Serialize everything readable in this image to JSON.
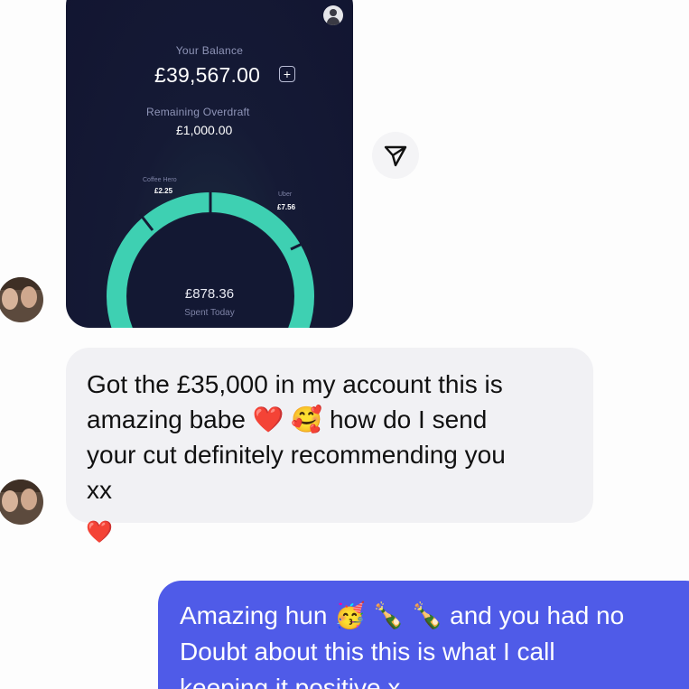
{
  "shared_image": {
    "balance_label": "Your Balance",
    "balance_value": "£39,567.00",
    "add_symbol": "+",
    "overdraft_label": "Remaining Overdraft",
    "overdraft_value": "£1,000.00",
    "segments": [
      {
        "label": "Coffee Hero",
        "value": "£2.25"
      },
      {
        "label": "Uber",
        "value": "£7.56"
      }
    ],
    "spent_value": "£878.36",
    "spent_label": "Spent Today",
    "colors": {
      "ring": "#3ed0b2",
      "background": "#151a35"
    }
  },
  "share_icon": "paper-plane-icon",
  "incoming_message": {
    "text": "Got the £35,000 in my account this is amazing babe ❤️ 🥰 how do I send your cut definitely recommending you xx",
    "lines": [
      "Got the £35,000 in my account this is",
      "amazing babe ❤️ 🥰 how do I send",
      "your cut definitely recommending you",
      "xx"
    ],
    "reaction": "❤️"
  },
  "outgoing_message": {
    "lines": [
      "Amazing hun 🥳 🍾 🍾 and you had no",
      "Doubt about this this is what I call",
      "keeping it positive x"
    ],
    "colors": {
      "bubble": "#4f5be8",
      "text": "#ffffff"
    }
  }
}
